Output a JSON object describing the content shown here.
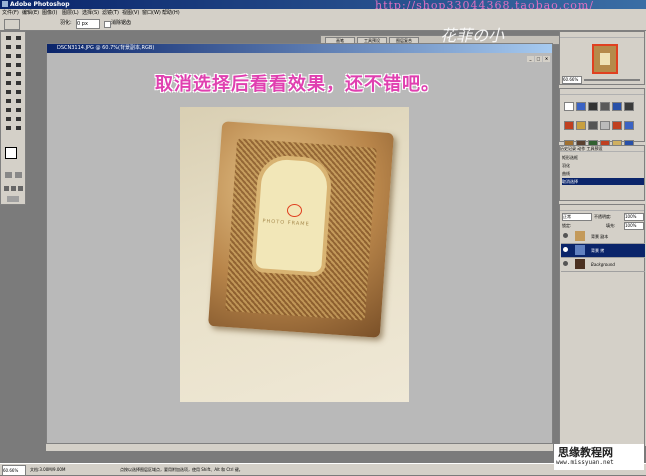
{
  "window": {
    "title": "Adobe Photoshop"
  },
  "watermark_url": "http://shop33044368.taobao.com/",
  "watermark_brand": "花菲の小",
  "menu": [
    "文件(F)",
    "编辑(E)",
    "图像(I)",
    "图层(L)",
    "选择(S)",
    "滤镜(T)",
    "视图(V)",
    "窗口(W)",
    "帮助(H)"
  ],
  "options": {
    "feather_label": "羽化:",
    "feather_value": "0 px",
    "antialias_label": "消除锯齿"
  },
  "palette_well": [
    "画笔",
    "工具预设",
    "图层复合"
  ],
  "document": {
    "title": "DSCN3114.JPG @ 60.7%(背景副本,RGB)"
  },
  "headline": "取消选择后看看效果，还不错吧。",
  "photo": {
    "frame_text": "PHOTO FRAME"
  },
  "navigator": {
    "zoom": "60.66%"
  },
  "history": {
    "tabs": "历史记录  动作  工具预设",
    "rows": [
      "矩形选框",
      "羽化",
      "曲线",
      "取消选择"
    ]
  },
  "layers": {
    "mode": "正常",
    "opacity_label": "不透明度:",
    "opacity": "100%",
    "lock_label": "锁定:",
    "fill_label": "填充:",
    "fill": "100%",
    "rows": [
      {
        "name": "背景 副本"
      },
      {
        "name": "背景 拷"
      },
      {
        "name": "Background"
      }
    ]
  },
  "status": {
    "zoom": "60.66%",
    "doc": "文档:3.00M/9.00M",
    "hint": "点按以选择图层区域点，要用附加选项，使用 Shift、Alt 和 Ctrl 键。"
  },
  "site": {
    "cn": "思缘教程网",
    "url": "www.missyuan.net"
  },
  "colors": {
    "accent": "#0a246a",
    "headline": "#e040b0"
  }
}
